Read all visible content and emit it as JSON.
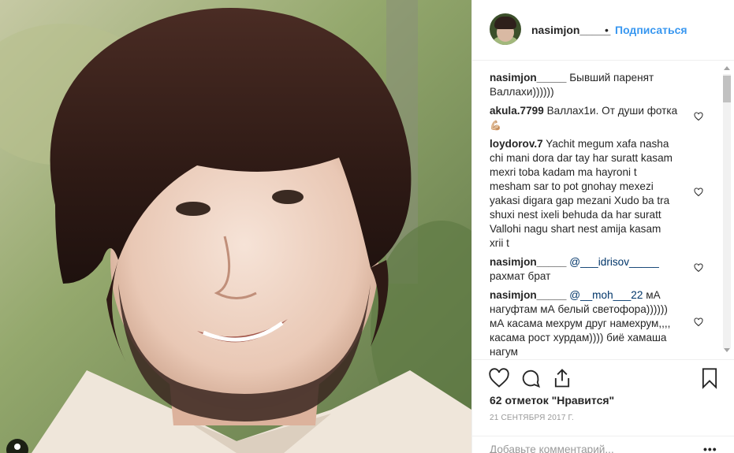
{
  "post": {
    "photo_icon": "tag-people-icon"
  },
  "header": {
    "username": "nasimjon_____",
    "separator": "•",
    "follow_label": "Подписаться"
  },
  "comments": [
    {
      "user": "nasimjon_____",
      "lines": [
        "Бывший паренят",
        "Валлахи))))))"
      ]
    },
    {
      "user": "akula.7799",
      "lines": [
        "Валлах1и. От души фотка",
        "💪🏼"
      ]
    },
    {
      "user": "loydorov.7",
      "lines": [
        "Yachit megum xafa nasha",
        "chi mani dora dar tay har suratt kasam",
        "mexri toba kadam ma hayroni t",
        "mesham sar to pot gnohay mexezi",
        "yakasi digara gap mezani Xudo ba tra",
        "shuxi nest ixeli behuda da har suratt",
        "Vallohi nagu shart nest amija kasam",
        "xrii t"
      ]
    },
    {
      "user": "nasimjon_____",
      "mention": "@___idrisov_____",
      "lines": [
        "рахмат брат"
      ]
    },
    {
      "user": "nasimjon_____",
      "mention": "@__moh___22",
      "first_text": "мА",
      "lines": [
        "нагуфтам мА белый светофора))))))",
        "мА касама мехрум друг намехрум,,,,",
        "касама рост хурдам)))) биё хамаша",
        "нагум"
      ]
    }
  ],
  "actions": {
    "likes": "62 отметок \"Нравится\"",
    "date": "21 СЕНТЯБРЯ 2017 Г.",
    "comment_placeholder": "Добавьте комментарий...",
    "more": "•••"
  },
  "colors": {
    "link": "#3897f0",
    "mention": "#003569",
    "muted": "#999999"
  }
}
